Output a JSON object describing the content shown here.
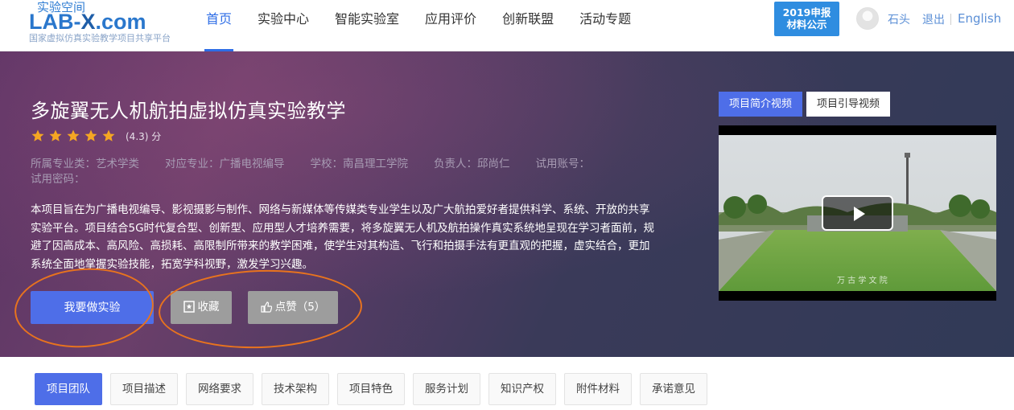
{
  "header": {
    "logo_top": "实验空间",
    "logo_main_a": "LAB-",
    "logo_main_b": "X",
    "logo_main_c": ".com",
    "logo_sub": "国家虚拟仿真实验教学项目共享平台",
    "nav": [
      "首页",
      "实验中心",
      "智能实验室",
      "应用评价",
      "创新联盟",
      "活动专题"
    ],
    "active_nav": "首页",
    "badge_line1": "2019申报",
    "badge_line2": "材料公示",
    "username": "石头",
    "logout": "退出",
    "language": "English"
  },
  "project": {
    "title": "多旋翼无人机航拍虚拟仿真实验教学",
    "rating_value": 4.3,
    "rating_text": "(4.3) 分",
    "stars_filled": 5,
    "meta": {
      "category": "所属专业类：艺术学类",
      "major": "对应专业：广播电视编导",
      "school": "学校：南昌理工学院",
      "leader": "负责人：邱尚仁",
      "trial_account": "试用账号：",
      "trial_password": "试用密码："
    },
    "description": "本项目旨在为广播电视编导、影视摄影与制作、网络与新媒体等传媒类专业学生以及广大航拍爱好者提供科学、系统、开放的共享实验平台。项目结合5G时代复合型、创新型、应用型人才培养需要，将多旋翼无人机及航拍操作真实系统地呈现在学习者面前，规避了因高成本、高风险、高损耗、高限制所带来的教学困难，使学生对其构造、飞行和拍摄手法有更直观的把握，虚实结合，更加系统全面地掌握实验技能，拓宽学科视野，激发学习兴趣。"
  },
  "actions": {
    "do_experiment": "我要做实验",
    "favorite": "收藏",
    "like": "点赞（5）"
  },
  "video": {
    "tab_intro": "项目简介视频",
    "tab_guide": "项目引导视频",
    "caption": "万 古 学 文 院"
  },
  "tabs": [
    "项目团队",
    "项目描述",
    "网络要求",
    "技术架构",
    "项目特色",
    "服务计划",
    "知识产权",
    "附件材料",
    "承诺意见"
  ],
  "colors": {
    "accent": "#4e6ee8",
    "annotation": "#e8731e",
    "star": "#f5a623"
  }
}
